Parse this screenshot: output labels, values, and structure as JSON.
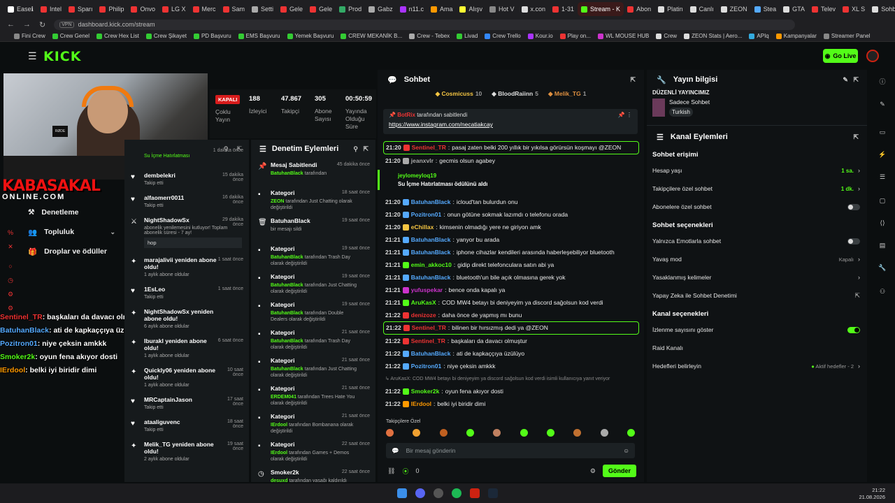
{
  "browser": {
    "tabs": [
      {
        "label": "Easeℹ",
        "color": "#ffffff"
      },
      {
        "label": "Intel",
        "color": "#e33"
      },
      {
        "label": "Sparı",
        "color": "#e33"
      },
      {
        "label": "Philip",
        "color": "#e33"
      },
      {
        "label": "Onvo",
        "color": "#e33"
      },
      {
        "label": "LG X",
        "color": "#e33"
      },
      {
        "label": "Merc",
        "color": "#e33"
      },
      {
        "label": "Sam",
        "color": "#e33"
      },
      {
        "label": "Setti",
        "color": "#aaa"
      },
      {
        "label": "Gele",
        "color": "#e33"
      },
      {
        "label": "Gele",
        "color": "#e33"
      },
      {
        "label": "Prod",
        "color": "#3a6"
      },
      {
        "label": "Gabz",
        "color": "#aaa"
      },
      {
        "label": "n11.c",
        "color": "#a3f"
      },
      {
        "label": "Ama",
        "color": "#f90"
      },
      {
        "label": "Alışv",
        "color": "#ff3"
      },
      {
        "label": "Hot V",
        "color": "#888"
      },
      {
        "label": "x.con",
        "color": "#ddd"
      },
      {
        "label": "1-31",
        "color": "#e33"
      },
      {
        "label": "Stream - K",
        "color": "#53fc18",
        "active": true
      },
      {
        "label": "Abon",
        "color": "#e33"
      },
      {
        "label": "Platin",
        "color": "#ddd"
      },
      {
        "label": "Canlı",
        "color": "#ddd"
      },
      {
        "label": "ZEON",
        "color": "#ddd"
      },
      {
        "label": "Stea",
        "color": "#5af"
      },
      {
        "label": "GTA",
        "color": "#ddd"
      },
      {
        "label": "Telev",
        "color": "#e33"
      },
      {
        "label": "XL S",
        "color": "#e33"
      },
      {
        "label": "Sohbt",
        "color": "#ddd"
      }
    ],
    "url": "dashboard.kick.com/stream",
    "vpn": "VPN",
    "bookmarks": [
      {
        "label": "Fini Crew",
        "color": "#888"
      },
      {
        "label": "Crew Genel",
        "color": "#3c3"
      },
      {
        "label": "Crew Hex List",
        "color": "#3c3"
      },
      {
        "label": "Crew Şikayet",
        "color": "#3c3"
      },
      {
        "label": "PD Başvuru",
        "color": "#3c3"
      },
      {
        "label": "EMS Başvuru",
        "color": "#3c3"
      },
      {
        "label": "Yemek Başvuru",
        "color": "#3c3"
      },
      {
        "label": "CREW MEKANİK B...",
        "color": "#3c3"
      },
      {
        "label": "Crew - Tebex",
        "color": "#aaa"
      },
      {
        "label": "Livad",
        "color": "#3c3"
      },
      {
        "label": "Crew Trello",
        "color": "#38f"
      },
      {
        "label": "Kour.io",
        "color": "#a3f"
      },
      {
        "label": "Play on...",
        "color": "#e33"
      },
      {
        "label": "WL MOUSE HUB",
        "color": "#c3c"
      },
      {
        "label": "Crew",
        "color": "#ddd"
      },
      {
        "label": "ZEON Stats | Aero...",
        "color": "#ddd"
      },
      {
        "label": "APIq",
        "color": "#3ad"
      },
      {
        "label": "Kampanyalar",
        "color": "#f90"
      },
      {
        "label": "Streamer Panel",
        "color": "#888"
      }
    ]
  },
  "kick": {
    "logo": "KICK",
    "go_live": "Go Live"
  },
  "overlay": {
    "brand_top": "KABASAKAL",
    "brand_bottom": "ONLINE.COM",
    "mic_label": "RØDE",
    "chat": [
      {
        "user": "Sentinel_TR",
        "text": " başkaları da davacı olmuştur",
        "color": "#e33"
      },
      {
        "user": "BatuhanBlack",
        "text": " ati de kapkaççıya üzülüyo",
        "color": "#5af"
      },
      {
        "user": "Pozitron01",
        "text": " niye çeksin amkkk",
        "color": "#5af"
      },
      {
        "user": "Smoker2k",
        "text": " oyun fena akıyor dosti",
        "color": "#53fc18"
      },
      {
        "user": "IErdool",
        "text": " belki iyi biridir dimi",
        "color": "#f90"
      }
    ]
  },
  "sidemenu": [
    {
      "label": "Denetleme",
      "icon": "hammer-icon"
    },
    {
      "label": "Topluluk",
      "icon": "people-icon",
      "chevron": true
    },
    {
      "label": "Droplar ve ödüller",
      "icon": "gift-icon"
    }
  ],
  "stats": {
    "status": "KAPALI",
    "status_label": "Çoklu Yayın",
    "viewers": "188",
    "viewers_label": "İzleyici",
    "followers": "47.867",
    "followers_label": "Takipçi",
    "subs": "305",
    "subs_label": "Abone Sayısı",
    "uptime": "00:50:59",
    "uptime_label": "Yayında Olduğu Süre"
  },
  "activity": {
    "partial_top": "Su İçme Hatırlatması",
    "partial_time": "1 dakika önce",
    "items": [
      {
        "icon": "heart",
        "name": "dembelekri",
        "time": "15 dakika önce",
        "sub": "Takip etti"
      },
      {
        "icon": "heart",
        "name": "alfaomerr0011",
        "time": "16 dakika önce",
        "sub": "Takip etti"
      },
      {
        "icon": "gift",
        "name": "NightShadowSx",
        "time": "29 dakika önce",
        "sub": "abonelik yenilemesini kutluyor! Toplam abonelik süresi - 7 ay!",
        "msg": "hop"
      },
      {
        "icon": "star",
        "name": "marajalivii yeniden abone oldu!",
        "time": "1 saat önce",
        "sub": "1 aylık abone oldular"
      },
      {
        "icon": "heart",
        "name": "1EsLeo",
        "time": "1 saat önce",
        "sub": "Takip etti"
      },
      {
        "icon": "star",
        "name": "NightShadowSx yeniden abone oldu!",
        "time": "",
        "sub": "6 aylık abone oldular"
      },
      {
        "icon": "star",
        "name": "Iburakl yeniden abone oldu!",
        "time": "6 saat önce",
        "sub": "1 aylık abone oldular"
      },
      {
        "icon": "star",
        "name": "Quickly06 yeniden abone oldu!",
        "time": "10 saat önce",
        "sub": "1 aylık abone oldular"
      },
      {
        "icon": "heart",
        "name": "MRCaptainJason",
        "time": "17 saat önce",
        "sub": "Takip etti"
      },
      {
        "icon": "heart",
        "name": "ataaliguvenc",
        "time": "18 saat önce",
        "sub": "Takip etti"
      },
      {
        "icon": "star",
        "name": "Melik_TG yeniden abone oldu!",
        "time": "19 saat önce",
        "sub": "2 aylık abone oldular"
      }
    ]
  },
  "modlog": {
    "title": "Denetim Eylemleri",
    "items": [
      {
        "icon": "pin",
        "name": "Mesaj Sabitlendi",
        "time": "45 dakika önce",
        "actor": "BatuhanBlack",
        "desc": " tarafından"
      },
      {
        "icon": "tag",
        "name": "Kategori",
        "time": "18 saat önce",
        "actor": "ZEON",
        "desc": " tarafından Just Chatting olarak değiştirildi"
      },
      {
        "icon": "trash",
        "name": "BatuhanBlack",
        "time": "19 saat önce",
        "actor": "",
        "desc": "bir mesajı sildi"
      },
      {
        "icon": "tag",
        "name": "Kategori",
        "time": "19 saat önce",
        "actor": "BatuhanBlack",
        "desc": " tarafından Trash Day olarak değiştirildi"
      },
      {
        "icon": "tag",
        "name": "Kategori",
        "time": "19 saat önce",
        "actor": "BatuhanBlack",
        "desc": " tarafından Just Chatting olarak değiştirildi"
      },
      {
        "icon": "tag",
        "name": "Kategori",
        "time": "19 saat önce",
        "actor": "BatuhanBlack",
        "desc": " tarafından Double Dealers olarak değiştirildi"
      },
      {
        "icon": "tag",
        "name": "Kategori",
        "time": "21 saat önce",
        "actor": "BatuhanBlack",
        "desc": " tarafından Trash Day olarak değiştirildi"
      },
      {
        "icon": "tag",
        "name": "Kategori",
        "time": "21 saat önce",
        "actor": "BatuhanBlack",
        "desc": " tarafından Just Chatting olarak değiştirildi"
      },
      {
        "icon": "tag",
        "name": "Kategori",
        "time": "21 saat önce",
        "actor": "ERDEM041",
        "desc": " tarafından Trees Hate You olarak değiştirildi"
      },
      {
        "icon": "tag",
        "name": "Kategori",
        "time": "21 saat önce",
        "actor": "IErdool",
        "desc": " tarafından Bombanana olarak değiştirildi"
      },
      {
        "icon": "tag",
        "name": "Kategori",
        "time": "22 saat önce",
        "actor": "IErdool",
        "desc": " tarafından Games + Demos olarak değiştirildi"
      },
      {
        "icon": "clock",
        "name": "Smoker2k",
        "time": "22 saat önce",
        "actor": "desuxd",
        "desc": " tarafından yasağı kaldırıldı"
      }
    ]
  },
  "chat": {
    "title": "Sohbet",
    "gifters": [
      {
        "name": "Cosmicuss",
        "count": "10",
        "color": "#f5c542"
      },
      {
        "name": "BloodRaiinn",
        "count": "5",
        "color": "#ddd"
      },
      {
        "name": "Melik_TG",
        "count": "1",
        "color": "#e09040"
      }
    ],
    "pinned_by": "BotRix",
    "pinned_suffix": " tarafından sabitlendi",
    "pinned_link": "https://www.instagram.com/necatiakcay",
    "reward_user": "jeylomeyloq19",
    "reward_text": "Su İçme Hatırlatması ödülünü aldı",
    "messages": [
      {
        "time": "21:20",
        "user": "Sentinel_TR",
        "color": "#e33",
        "text": "pasaj zaten belki 200 yıllık bir yıkılsa görürsün koşmayı @ZEON",
        "hl": true
      },
      {
        "time": "21:20",
        "user": "jeanxvlr",
        "color": "#aaa",
        "text": "gecmis olsun agabey"
      },
      {
        "gap": true
      },
      {
        "time": "21:20",
        "user": "BatuhanBlack",
        "color": "#5af",
        "text": "icloud'tan bulurdun onu"
      },
      {
        "time": "21:20",
        "user": "Pozitron01",
        "color": "#5af",
        "text": "onun götüne sokmak lazımdı o telefonu orada"
      },
      {
        "time": "21:20",
        "user": "eChillax",
        "color": "#f5c542",
        "text": "kimsenin olmadığı yere ne giriyon amk"
      },
      {
        "time": "21:21",
        "user": "BatuhanBlack",
        "color": "#5af",
        "text": "yanyor bu arada"
      },
      {
        "time": "21:21",
        "user": "BatuhanBlack",
        "color": "#5af",
        "text": "iphone cihazlar kendileri arasında haberleşebiliyor bluetooth"
      },
      {
        "time": "21:21",
        "user": "emin_akkoc10",
        "color": "#53fc18",
        "text": "gidip direkt telefonculara satın abi ya"
      },
      {
        "time": "21:21",
        "user": "BatuhanBlack",
        "color": "#5af",
        "text": "bluetooth'un bile açık olmasına gerek yok"
      },
      {
        "time": "21:21",
        "user": "yufuspekar",
        "color": "#c3c",
        "text": "bence onda kapalı ya"
      },
      {
        "time": "21:21",
        "user": "AruKasX",
        "color": "#53fc18",
        "text": "COD MW4 betayı bi deniyeyim ya discord sağolsun kod verdi"
      },
      {
        "time": "21:22",
        "user": "denizoze",
        "color": "#e33",
        "text": "daha önce de yapmış mı bunu"
      },
      {
        "time": "21:22",
        "user": "Sentinel_TR",
        "color": "#e33",
        "text": "bilinen bir hırsızmış dedi ya @ZEON",
        "hl": true
      },
      {
        "time": "21:22",
        "user": "Sentinel_TR",
        "color": "#e33",
        "text": "başkaları da davacı olmuştur"
      },
      {
        "time": "21:22",
        "user": "BatuhanBlack",
        "color": "#5af",
        "text": "ati de kapkaççıya üzülüyo"
      },
      {
        "time": "21:22",
        "user": "Pozitron01",
        "color": "#5af",
        "text": "niye çeksin amkkk"
      },
      {
        "sys": "↳ AruKasX: COD MW4 betayı bi deniyeyim ya discord sağolsun kod verdi isimli kullanıcıya yanıt veriyor"
      },
      {
        "time": "21:22",
        "user": "Smoker2k",
        "color": "#53fc18",
        "text": "oyun fena akıyor dosti"
      },
      {
        "time": "21:22",
        "user": "IErdool",
        "color": "#f90",
        "text": "belki iyi biridir dimi"
      }
    ],
    "followers_only": "Takipçilere Özel",
    "input_placeholder": "Bir mesaj gönderin",
    "kicks_count": "0",
    "send_label": "Gönder"
  },
  "right": {
    "stream_info_title": "Yayın bilgisi",
    "regular_streamer": "DÜZENLİ YAYINCIMIZ",
    "category": "Sadece Sohbet",
    "language": "Turkish",
    "channel_actions_title": "Kanal Eylemleri",
    "chat_access": "Sohbet erişimi",
    "account_age": "Hesap yaşı",
    "account_age_val": "1 sa.",
    "followers_only": "Takipçilere özel sohbet",
    "followers_only_val": "1 dk.",
    "subs_only": "Abonelere özel sohbet",
    "chat_options": "Sohbet seçenekleri",
    "emotes_only": "Yalnızca Emotlarla sohbet",
    "slow_mode": "Yavaş mod",
    "slow_mode_val": "Kapalı",
    "banned_words": "Yasaklanmış kelimeler",
    "ai_moderation": "Yapay Zeka ile Sohbet Denetimi",
    "channel_options": "Kanal seçenekleri",
    "show_viewer_count": "İzlenme sayısını göster",
    "raid_channel": "Raid Kanalı",
    "goals": "Hedefleri belirleyin",
    "goals_val": "Aktif hedefler - 2"
  },
  "taskbar": {
    "time": "21:22",
    "date": "21.08.2026"
  }
}
